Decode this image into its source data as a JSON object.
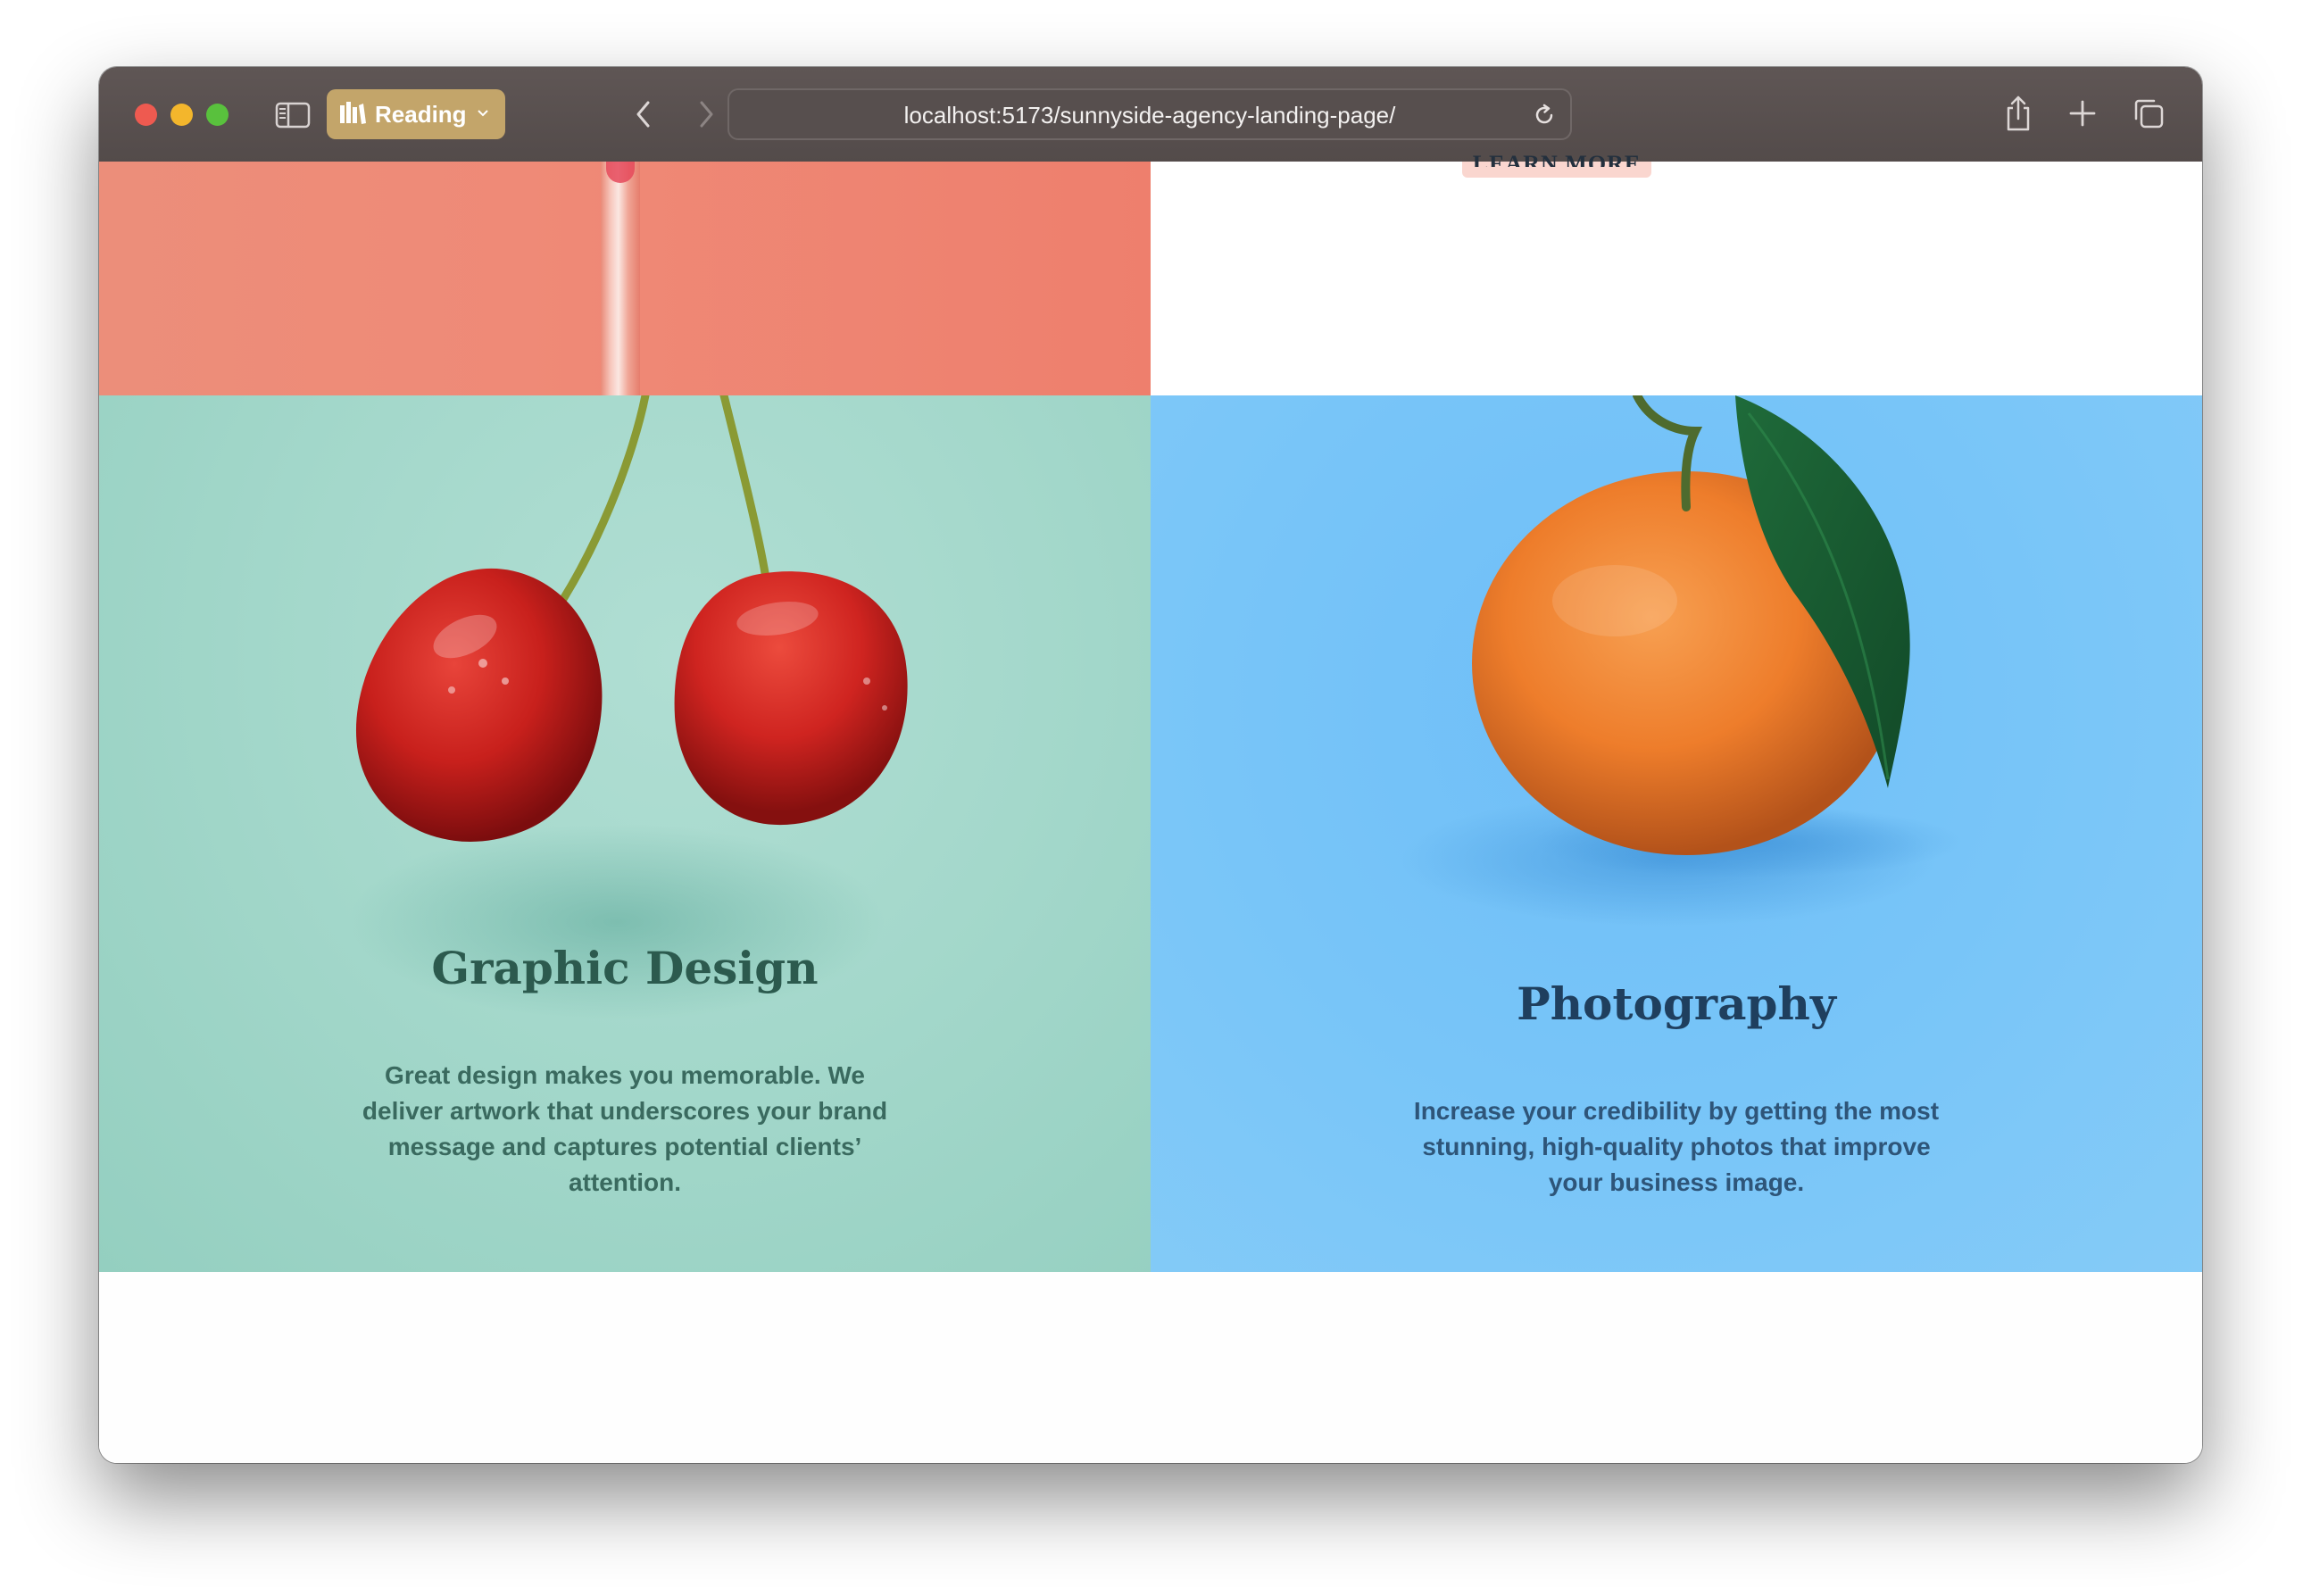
{
  "browser": {
    "reader_label": "Reading",
    "url": "localhost:5173/sunnyside-agency-landing-page/",
    "icons": [
      "sidebar-icon",
      "reading-list-icon",
      "chevron-down-icon",
      "back-icon",
      "forward-icon",
      "reload-icon",
      "share-icon",
      "plus-icon",
      "tabs-icon"
    ]
  },
  "page": {
    "partial_link": "LEARN MORE",
    "services": [
      {
        "title": "Graphic Design",
        "description": "Great design makes you memorable. We deliver artwork that underscores your brand message and captures potential clients’ attention.",
        "accent": "#a3d9cc"
      },
      {
        "title": "Photography",
        "description": "Increase your credibility by getting the most stunning, high-quality photos that improve your business image.",
        "accent": "#7ac5f8"
      }
    ],
    "colors": {
      "salmon_tile": "#ee8a77",
      "graphic_title": "#2c5a4e",
      "photo_title": "#1f3f5e"
    }
  }
}
